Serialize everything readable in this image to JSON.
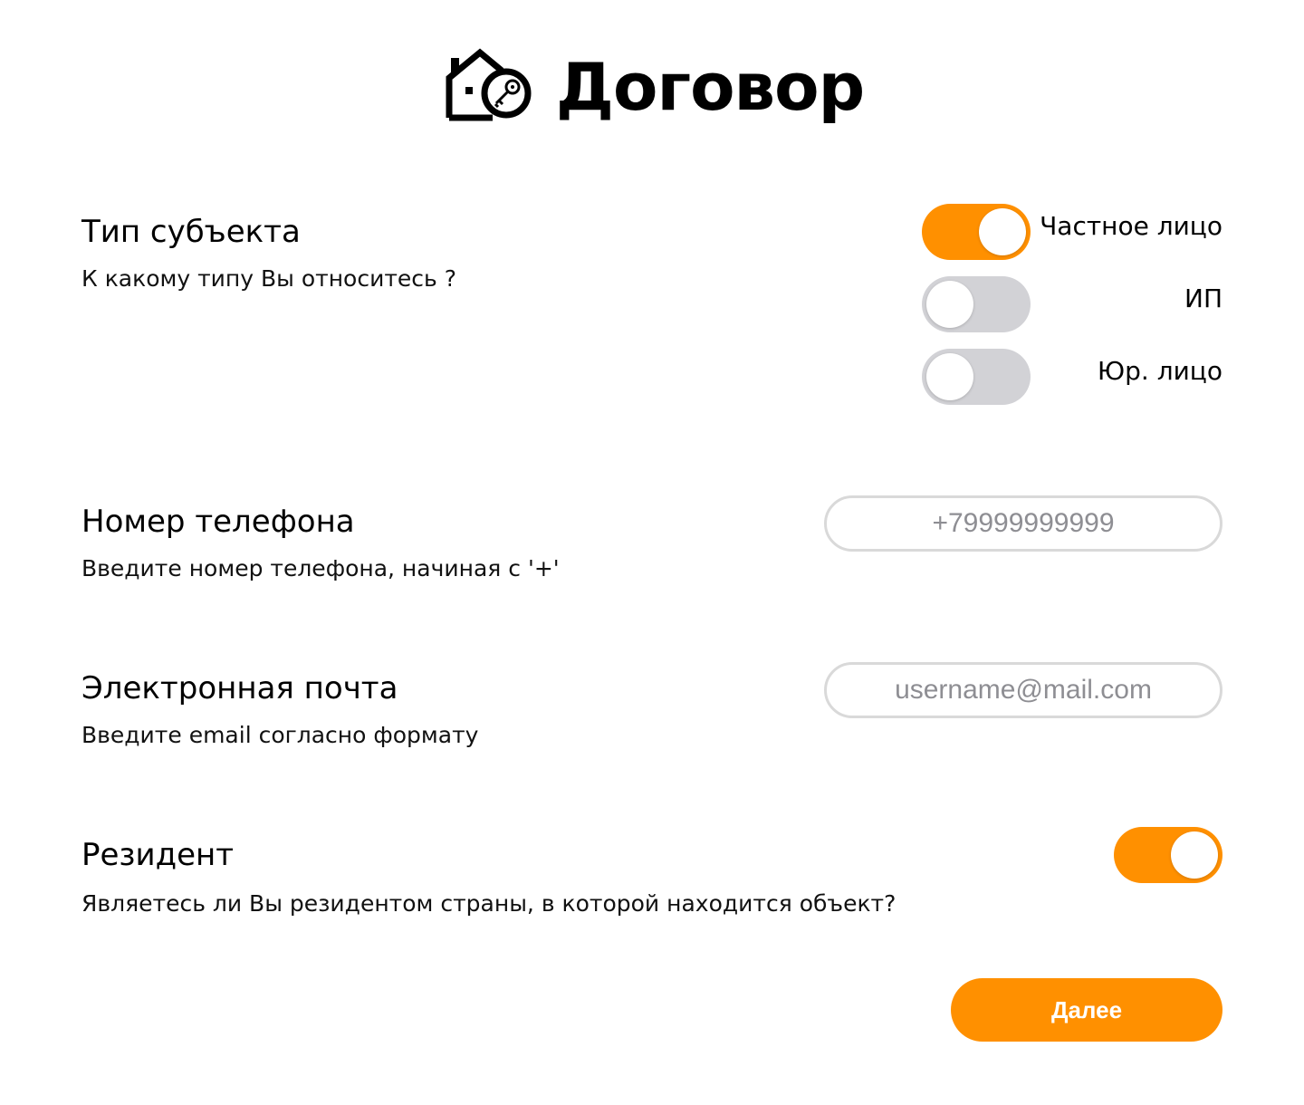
{
  "header": {
    "title": "Договор",
    "logo_icon": "house-key-icon"
  },
  "subject_type": {
    "title": "Тип субъекта",
    "description": "К какому типу Вы относитесь ?",
    "options": [
      {
        "label": "Частное лицо",
        "selected": true
      },
      {
        "label": "ИП",
        "selected": false
      },
      {
        "label": "Юр. лицо",
        "selected": false
      }
    ]
  },
  "phone": {
    "title": "Номер телефона",
    "description": "Введите номер телефона, начиная с '+'",
    "value": "",
    "placeholder": "+79999999999"
  },
  "email": {
    "title": "Электронная почта",
    "description": "Введите email согласно формату",
    "value": "",
    "placeholder": "username@mail.com"
  },
  "resident": {
    "title": "Резидент",
    "description": "Являетесь ли Вы резидентом страны, в которой находится объект?",
    "enabled": true
  },
  "actions": {
    "next_label": "Далее"
  },
  "colors": {
    "accent": "#ff9000",
    "toggle_off": "#d2d2d6",
    "field_border": "#d9d9d9",
    "placeholder": "#8e8e93"
  }
}
